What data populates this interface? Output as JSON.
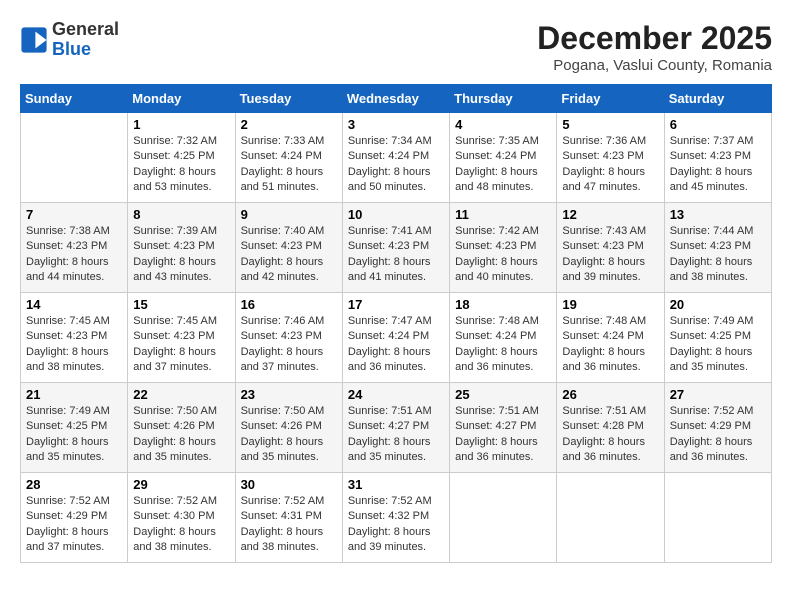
{
  "header": {
    "logo_general": "General",
    "logo_blue": "Blue",
    "month_title": "December 2025",
    "location": "Pogana, Vaslui County, Romania"
  },
  "days_of_week": [
    "Sunday",
    "Monday",
    "Tuesday",
    "Wednesday",
    "Thursday",
    "Friday",
    "Saturday"
  ],
  "weeks": [
    [
      {
        "day": "",
        "info": ""
      },
      {
        "day": "1",
        "info": "Sunrise: 7:32 AM\nSunset: 4:25 PM\nDaylight: 8 hours\nand 53 minutes."
      },
      {
        "day": "2",
        "info": "Sunrise: 7:33 AM\nSunset: 4:24 PM\nDaylight: 8 hours\nand 51 minutes."
      },
      {
        "day": "3",
        "info": "Sunrise: 7:34 AM\nSunset: 4:24 PM\nDaylight: 8 hours\nand 50 minutes."
      },
      {
        "day": "4",
        "info": "Sunrise: 7:35 AM\nSunset: 4:24 PM\nDaylight: 8 hours\nand 48 minutes."
      },
      {
        "day": "5",
        "info": "Sunrise: 7:36 AM\nSunset: 4:23 PM\nDaylight: 8 hours\nand 47 minutes."
      },
      {
        "day": "6",
        "info": "Sunrise: 7:37 AM\nSunset: 4:23 PM\nDaylight: 8 hours\nand 45 minutes."
      }
    ],
    [
      {
        "day": "7",
        "info": "Sunrise: 7:38 AM\nSunset: 4:23 PM\nDaylight: 8 hours\nand 44 minutes."
      },
      {
        "day": "8",
        "info": "Sunrise: 7:39 AM\nSunset: 4:23 PM\nDaylight: 8 hours\nand 43 minutes."
      },
      {
        "day": "9",
        "info": "Sunrise: 7:40 AM\nSunset: 4:23 PM\nDaylight: 8 hours\nand 42 minutes."
      },
      {
        "day": "10",
        "info": "Sunrise: 7:41 AM\nSunset: 4:23 PM\nDaylight: 8 hours\nand 41 minutes."
      },
      {
        "day": "11",
        "info": "Sunrise: 7:42 AM\nSunset: 4:23 PM\nDaylight: 8 hours\nand 40 minutes."
      },
      {
        "day": "12",
        "info": "Sunrise: 7:43 AM\nSunset: 4:23 PM\nDaylight: 8 hours\nand 39 minutes."
      },
      {
        "day": "13",
        "info": "Sunrise: 7:44 AM\nSunset: 4:23 PM\nDaylight: 8 hours\nand 38 minutes."
      }
    ],
    [
      {
        "day": "14",
        "info": "Sunrise: 7:45 AM\nSunset: 4:23 PM\nDaylight: 8 hours\nand 38 minutes."
      },
      {
        "day": "15",
        "info": "Sunrise: 7:45 AM\nSunset: 4:23 PM\nDaylight: 8 hours\nand 37 minutes."
      },
      {
        "day": "16",
        "info": "Sunrise: 7:46 AM\nSunset: 4:23 PM\nDaylight: 8 hours\nand 37 minutes."
      },
      {
        "day": "17",
        "info": "Sunrise: 7:47 AM\nSunset: 4:24 PM\nDaylight: 8 hours\nand 36 minutes."
      },
      {
        "day": "18",
        "info": "Sunrise: 7:48 AM\nSunset: 4:24 PM\nDaylight: 8 hours\nand 36 minutes."
      },
      {
        "day": "19",
        "info": "Sunrise: 7:48 AM\nSunset: 4:24 PM\nDaylight: 8 hours\nand 36 minutes."
      },
      {
        "day": "20",
        "info": "Sunrise: 7:49 AM\nSunset: 4:25 PM\nDaylight: 8 hours\nand 35 minutes."
      }
    ],
    [
      {
        "day": "21",
        "info": "Sunrise: 7:49 AM\nSunset: 4:25 PM\nDaylight: 8 hours\nand 35 minutes."
      },
      {
        "day": "22",
        "info": "Sunrise: 7:50 AM\nSunset: 4:26 PM\nDaylight: 8 hours\nand 35 minutes."
      },
      {
        "day": "23",
        "info": "Sunrise: 7:50 AM\nSunset: 4:26 PM\nDaylight: 8 hours\nand 35 minutes."
      },
      {
        "day": "24",
        "info": "Sunrise: 7:51 AM\nSunset: 4:27 PM\nDaylight: 8 hours\nand 35 minutes."
      },
      {
        "day": "25",
        "info": "Sunrise: 7:51 AM\nSunset: 4:27 PM\nDaylight: 8 hours\nand 36 minutes."
      },
      {
        "day": "26",
        "info": "Sunrise: 7:51 AM\nSunset: 4:28 PM\nDaylight: 8 hours\nand 36 minutes."
      },
      {
        "day": "27",
        "info": "Sunrise: 7:52 AM\nSunset: 4:29 PM\nDaylight: 8 hours\nand 36 minutes."
      }
    ],
    [
      {
        "day": "28",
        "info": "Sunrise: 7:52 AM\nSunset: 4:29 PM\nDaylight: 8 hours\nand 37 minutes."
      },
      {
        "day": "29",
        "info": "Sunrise: 7:52 AM\nSunset: 4:30 PM\nDaylight: 8 hours\nand 38 minutes."
      },
      {
        "day": "30",
        "info": "Sunrise: 7:52 AM\nSunset: 4:31 PM\nDaylight: 8 hours\nand 38 minutes."
      },
      {
        "day": "31",
        "info": "Sunrise: 7:52 AM\nSunset: 4:32 PM\nDaylight: 8 hours\nand 39 minutes."
      },
      {
        "day": "",
        "info": ""
      },
      {
        "day": "",
        "info": ""
      },
      {
        "day": "",
        "info": ""
      }
    ]
  ]
}
